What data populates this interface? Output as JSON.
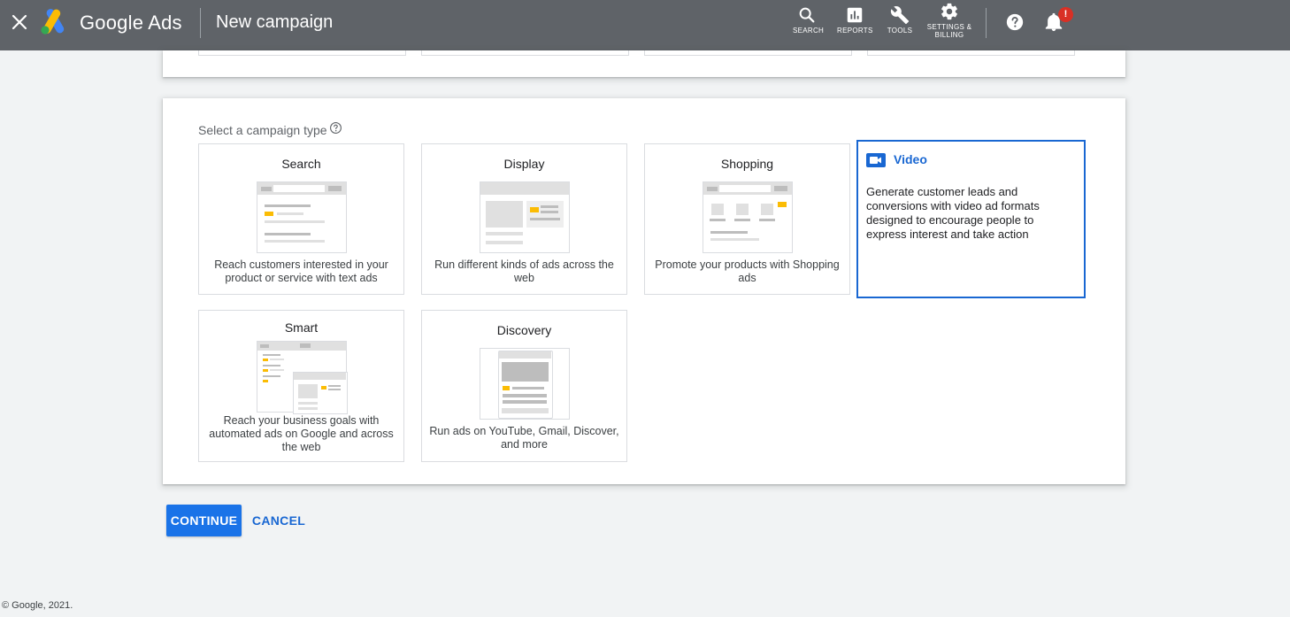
{
  "header": {
    "app_name": "Google Ads",
    "page_title": "New campaign",
    "nav": [
      {
        "label": "SEARCH",
        "icon": "search-icon"
      },
      {
        "label": "REPORTS",
        "icon": "reports-icon"
      },
      {
        "label": "TOOLS",
        "icon": "wrench-icon"
      },
      {
        "label_line1": "SETTINGS &",
        "label_line2": "BILLING",
        "icon": "gear-icon"
      }
    ],
    "notification_badge": "!"
  },
  "campaign_types": {
    "label": "Select a campaign type",
    "items": [
      {
        "name": "Search",
        "description": "Reach customers interested in your product or service with text ads"
      },
      {
        "name": "Display",
        "description": "Run different kinds of ads across the web"
      },
      {
        "name": "Shopping",
        "description": "Promote your products with Shopping ads"
      },
      {
        "name": "Video",
        "description": "Generate customer leads and conversions with video ad formats designed to encourage people to express interest and take action",
        "selected": true
      },
      {
        "name": "Smart",
        "description": "Reach your business goals with automated ads on Google and across the web"
      },
      {
        "name": "Discovery",
        "description": "Run ads on YouTube, Gmail, Discover, and more"
      }
    ]
  },
  "actions": {
    "continue_label": "CONTINUE",
    "cancel_label": "CANCEL"
  },
  "footer": {
    "copyright": "© Google, 2021."
  },
  "colors": {
    "topbar": "#5f6368",
    "accent": "#1a73e8",
    "selected_border": "#1967d2",
    "badge": "#d93025",
    "illustration_highlight": "#fbbc04"
  }
}
